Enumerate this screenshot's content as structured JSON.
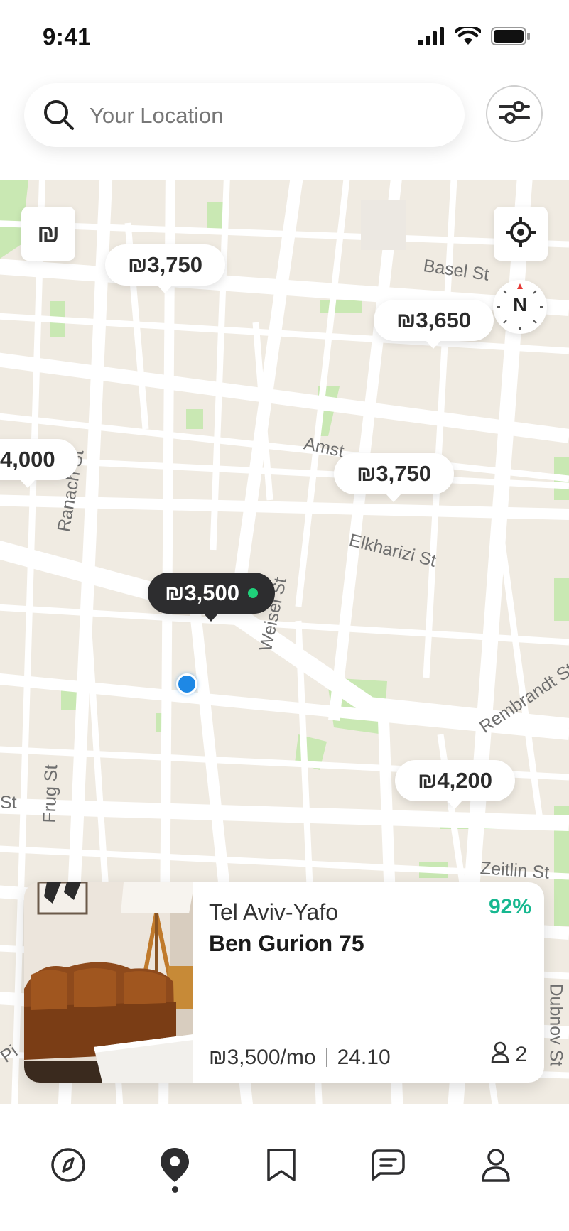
{
  "status_bar": {
    "time": "9:41",
    "icons": [
      "signal-icon",
      "wifi-icon",
      "battery-icon"
    ]
  },
  "search": {
    "placeholder": "Your Location",
    "value": "",
    "icon": "search-icon",
    "filter_icon": "sliders-icon"
  },
  "map": {
    "currency_button": "₪",
    "compass_label": "N",
    "locate_icon": "crosshair-icon",
    "streets": [
      "Basel St",
      "Amst",
      "Ranach St",
      "Elkharizi St",
      "Weisel St",
      "Rembrandt St",
      "Frug St",
      "Zeitlin St",
      "Dubnov St",
      "Pi",
      "St"
    ],
    "price_pins": [
      {
        "label": "₪3,750",
        "active": false
      },
      {
        "label": "₪3,650",
        "active": false
      },
      {
        "label": "4,000",
        "active": false
      },
      {
        "label": "₪3,750",
        "active": false
      },
      {
        "label": "₪3,500",
        "active": true
      },
      {
        "label": "₪4,200",
        "active": false
      }
    ],
    "colors": {
      "land": "#f0ebe2",
      "road": "#ffffff",
      "park": "#c9e8b3",
      "user_dot": "#1e88e5",
      "pin_active": "#2d2d2f",
      "pin_status": "#1fd07a"
    }
  },
  "listing": {
    "city": "Tel Aviv-Yafo",
    "street": "Ben Gurion 75",
    "match": "92%",
    "price": "₪3,500/mo",
    "date": "24.10",
    "occupants": "2",
    "occupants_icon": "person-icon",
    "match_color": "#17b890"
  },
  "bottom_nav": {
    "items": [
      {
        "icon": "compass-icon",
        "active": false
      },
      {
        "icon": "map-pin-icon",
        "active": true
      },
      {
        "icon": "bookmark-icon",
        "active": false
      },
      {
        "icon": "chat-icon",
        "active": false
      },
      {
        "icon": "profile-icon",
        "active": false
      }
    ]
  }
}
